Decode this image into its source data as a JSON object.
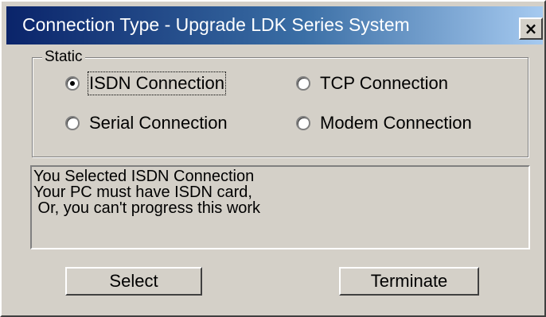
{
  "window": {
    "title": "Connection Type - Upgrade LDK Series System",
    "close_symbol": "×"
  },
  "group": {
    "label": "Static",
    "options": [
      {
        "label": "ISDN Connection",
        "selected": true
      },
      {
        "label": "TCP Connection",
        "selected": false
      },
      {
        "label": "Serial Connection",
        "selected": false
      },
      {
        "label": "Modem Connection",
        "selected": false
      }
    ]
  },
  "message": {
    "lines": [
      "You Selected ISDN Connection",
      "Your PC must have ISDN card,",
      " Or, you can't progress this work"
    ]
  },
  "buttons": {
    "select": "Select",
    "terminate": "Terminate"
  }
}
